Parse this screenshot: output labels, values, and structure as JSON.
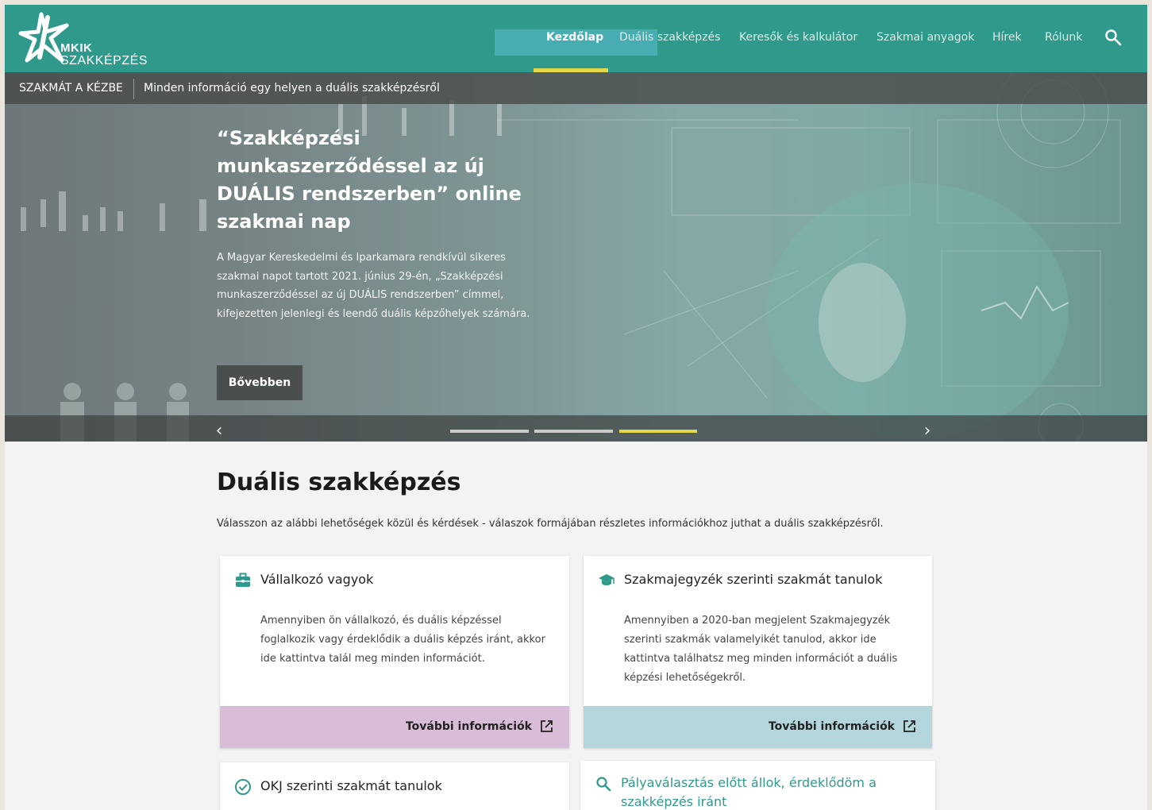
{
  "brand": {
    "line1": "MKIK",
    "line2": "SZAKKÉPZÉS"
  },
  "colors": {
    "primary": "#2f9a8c",
    "accent": "#e3d84c",
    "card1_footer": "#d9bcd8",
    "card2_footer": "#b3d6dd"
  },
  "nav": {
    "items": [
      {
        "label": "Kezdőlap",
        "active": true
      },
      {
        "label": "Duális szakképzés",
        "active": false
      },
      {
        "label": "Keresők és kalkulátor",
        "active": false
      },
      {
        "label": "Szakmai anyagok",
        "active": false
      },
      {
        "label": "Hírek",
        "active": false
      },
      {
        "label": "Rólunk",
        "active": false
      }
    ],
    "search_icon": "search-icon"
  },
  "hero": {
    "strip_label": "SZAKMÁT A KÉZBE",
    "strip_text": "Minden információ egy helyen a duális szakképzésről",
    "title": "“Szakképzési munkaszerződéssel az új DUÁLIS rendszerben” online szakmai nap",
    "text": "A Magyar Kereskedelmi és Iparkamara rendkívül sikeres szakmai napot tartott 2021. június 29-én, „Szakképzési munkaszerződéssel az új DUÁLIS rendszerben” címmel, kifejezetten jelenlegi és leendő duális képzőhelyek számára.",
    "button": "Bővebben",
    "prev_icon": "chevron-left-icon",
    "next_icon": "chevron-right-icon",
    "slide_count": 3,
    "active_slide": 3
  },
  "section": {
    "title": "Duális szakképzés",
    "subtitle": "Válasszon az alábbi lehetőségek közül és kérdések - válaszok formájában részletes információkhoz juthat a duális szakképzésről."
  },
  "cards": [
    {
      "icon": "briefcase-icon",
      "title": "Vállalkozó vagyok",
      "text": "Amennyiben ön vállalkozó, és duális képzéssel foglalkozik vagy érdeklődik a duális képzés iránt, akkor ide kattintva talál meg minden információt.",
      "link": "További információk"
    },
    {
      "icon": "graduation-cap-icon",
      "title": "Szakmajegyzék szerinti szakmát tanulok",
      "text": "Amennyiben a 2020-ban megjelent Szakmajegyzék szerinti szakmák valamelyikét tanulod, akkor ide kattintva találhatsz meg minden információt a duális képzési lehetőségekről.",
      "link": "További információk"
    },
    {
      "icon": "check-circle-icon",
      "title": "OKJ szerinti szakmát tanulok"
    },
    {
      "icon": "search-icon",
      "title": "Pályaválasztás előtt állok, érdeklődöm a szakképzés iránt"
    }
  ]
}
